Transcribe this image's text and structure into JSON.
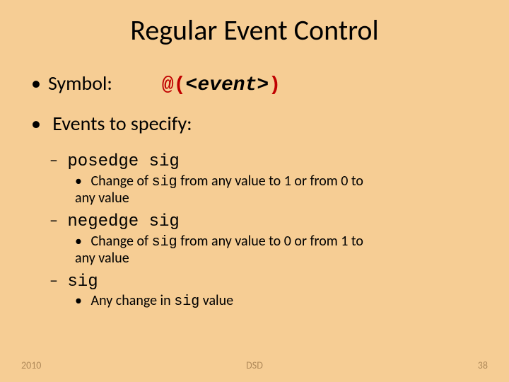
{
  "title": "Regular Event Control",
  "symbol": {
    "label": "Symbol:",
    "at": "@",
    "lpar": "(",
    "lt": "<",
    "word": "event",
    "gt": ">",
    "rpar": ")"
  },
  "events_heading": "Events to specify:",
  "items": [
    {
      "name": "posedge sig",
      "desc_pre": "Change of ",
      "desc_code": "sig",
      "desc_post": " from any value to 1 or from 0 to any value"
    },
    {
      "name": "negedge sig",
      "desc_pre": "Change of ",
      "desc_code": "sig",
      "desc_post": " from any value to 0 or from 1 to any value"
    },
    {
      "name": "sig",
      "desc_pre": "Any change in ",
      "desc_code": "sig",
      "desc_post": " value"
    }
  ],
  "footer": {
    "year": "2010",
    "mid": "DSD",
    "num": "38"
  }
}
